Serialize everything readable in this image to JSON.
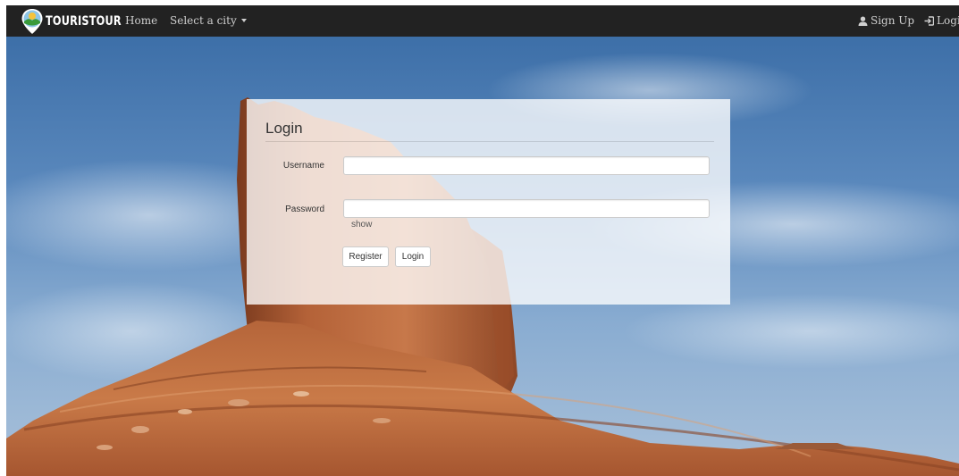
{
  "navbar": {
    "brand": "TOURISTOUR",
    "brand_icon": "map-pin-logo-icon",
    "home": "Home",
    "city_select": "Select a city",
    "sign_up": "Sign Up",
    "login": "Login"
  },
  "login_form": {
    "title": "Login",
    "username_label": "Username",
    "username_value": "",
    "password_label": "Password",
    "password_value": "",
    "show_toggle": "show",
    "register_button": "Register",
    "login_button": "Login"
  },
  "colors": {
    "navbar_bg": "#222222",
    "sky": "#5b89bd",
    "rock": "#b8643a"
  }
}
